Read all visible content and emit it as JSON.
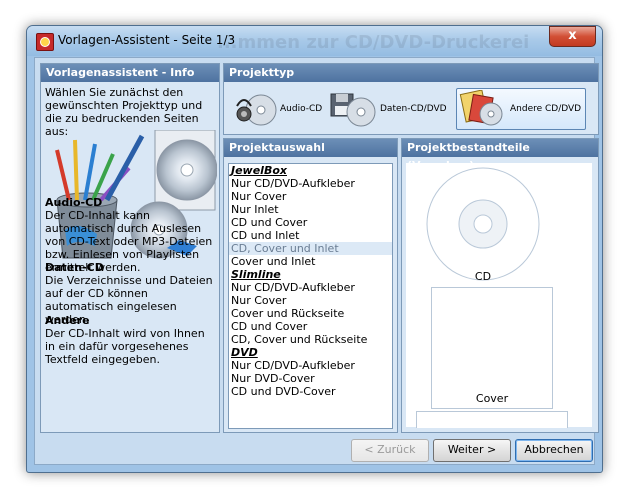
{
  "window": {
    "title": "Vorlagen-Assistent - Seite 1/3",
    "watermark": "...mmen zur CD/DVD-Druckerei",
    "close_label": "x"
  },
  "info_panel": {
    "header": "Vorlagenassistent - Info",
    "intro": "Wählen Sie zunächst den gewünschten Projekttyp und die zu bedruckenden Seiten aus:",
    "sections": [
      {
        "title": "Audio-CD",
        "text": "Der CD-Inhalt kann automatisch durch Auslesen von CD-Text oder MP3-Dateien bzw. Einlesen von Playlisten ermittelt werden."
      },
      {
        "title": "Daten-CD",
        "text": "Die Verzeichnisse und Dateien auf der CD können automatisch eingelesen werden."
      },
      {
        "title": "Andere",
        "text": "Der CD-Inhalt wird von Ihnen in ein dafür vorgesehenes Textfeld eingegeben."
      }
    ]
  },
  "project_type": {
    "header": "Projekttyp",
    "options": [
      {
        "label": "Audio-CD",
        "icon": "audio-cd-icon",
        "selected": false
      },
      {
        "label": "Daten-CD/DVD",
        "icon": "data-disc-icon",
        "selected": false
      },
      {
        "label": "Andere CD/DVD",
        "icon": "other-disc-icon",
        "selected": true
      }
    ]
  },
  "project_select": {
    "header": "Projektauswahl",
    "groups": [
      {
        "name": "JewelBox",
        "items": [
          "Nur CD/DVD-Aufkleber",
          "Nur Cover",
          "Nur Inlet",
          "CD und Cover",
          "CD und Inlet",
          "CD, Cover und Inlet",
          "Cover und Inlet"
        ]
      },
      {
        "name": "Slimline",
        "items": [
          "Nur CD/DVD-Aufkleber",
          "Nur Cover",
          "Cover und Rückseite",
          "CD und Cover",
          "CD, Cover und Rückseite"
        ]
      },
      {
        "name": "DVD",
        "items": [
          "Nur CD/DVD-Aufkleber",
          "Nur DVD-Cover",
          "CD und DVD-Cover"
        ]
      }
    ],
    "selected_item": "CD, Cover und Inlet"
  },
  "project_parts": {
    "header": "Projektbestandteile (Vorschau)",
    "cd_label": "CD",
    "cover_label": "Cover"
  },
  "buttons": {
    "back": "< Zurück",
    "next": "Weiter >",
    "cancel": "Abbrechen"
  },
  "colors": {
    "panel_header": "#4e72a0",
    "selection": "#dce9f6",
    "close_button": "#c23a22"
  }
}
